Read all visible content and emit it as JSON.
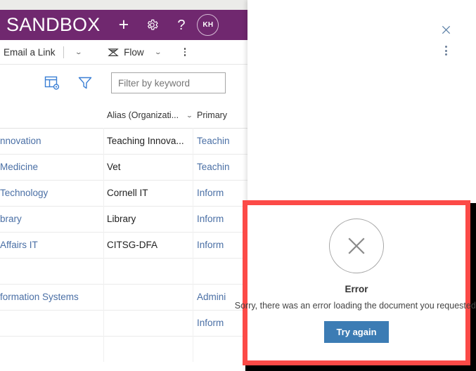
{
  "suite": {
    "title": "SANDBOX",
    "brand_color": "#70286f",
    "actions": [
      {
        "name": "new-button",
        "glyph": "+"
      },
      {
        "name": "settings-button",
        "glyph": "gear-icon"
      },
      {
        "name": "help-button",
        "glyph": "?"
      }
    ],
    "avatar_initials": "KH"
  },
  "command_bar": {
    "email_a_link": "Email a Link",
    "flow": "Flow",
    "overflow_label": "..."
  },
  "toolbar": {
    "view_icon": "edit-view-icon",
    "filter_icon": "filter-funnel-icon",
    "accent_color": "#3a7fd5"
  },
  "search": {
    "value": "",
    "placeholder": "Filter by keyword"
  },
  "table": {
    "columns": [
      {
        "label": "",
        "sortable": false
      },
      {
        "label": "Alias (Organizati...",
        "sortable": true
      },
      {
        "label": "Primary",
        "sortable": false
      }
    ],
    "rows": [
      {
        "name": "nnovation",
        "alias": "Teaching Innova...",
        "primary": "Teachin"
      },
      {
        "name": " Medicine",
        "alias": "Vet",
        "primary": "Teachin"
      },
      {
        "name": "Technology",
        "alias": "Cornell IT",
        "primary": "Inform"
      },
      {
        "name": "brary",
        "alias": "Library",
        "primary": "Inform"
      },
      {
        "name": " Affairs IT",
        "alias": "CITSG-DFA",
        "primary": "Inform"
      },
      {
        "name": "",
        "alias": "",
        "primary": ""
      },
      {
        "name": "formation Systems",
        "alias": "",
        "primary": "Admini"
      },
      {
        "name": "",
        "alias": "",
        "primary": "Inform"
      }
    ]
  },
  "panel": {
    "close_icon": "close-x-icon",
    "more_icon": "more-vertical-icon"
  },
  "error_dialog": {
    "icon": "error-x-circle-icon",
    "title": "Error",
    "message": "Sorry, there was an error loading the document you requested.",
    "button_label": "Try again",
    "button_color": "#3c7cb4",
    "highlight_color": "#fc4a47"
  }
}
